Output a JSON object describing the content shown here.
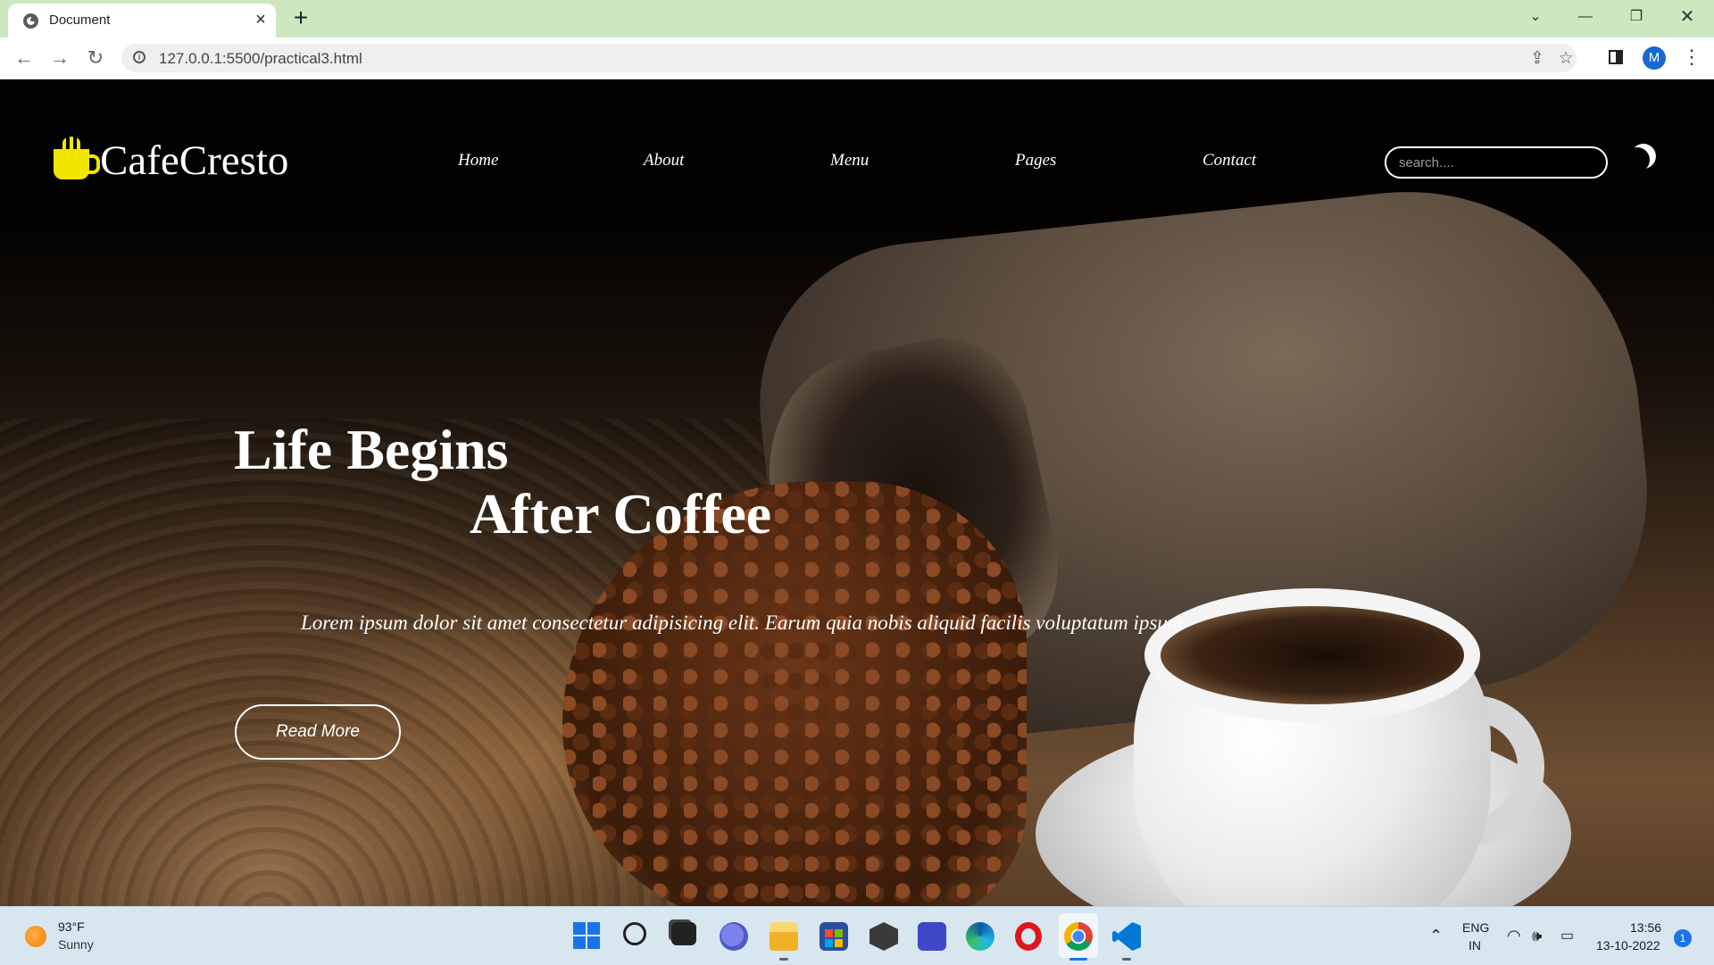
{
  "browser": {
    "tab_title": "Document",
    "url": "127.0.0.1:5500/practical3.html",
    "profile_initial": "M"
  },
  "site": {
    "logo_text": "CafeCresto",
    "nav": [
      "Home",
      "About",
      "Menu",
      "Pages",
      "Contact"
    ],
    "search_placeholder": "search...."
  },
  "hero": {
    "title_line1": "Life Begins",
    "title_line2": "After Coffee",
    "paragraph": "Lorem ipsum dolor sit amet consectetur adipisicing elit. Earum quia nobis aliquid facilis voluptatum ipsum",
    "button_label": "Read More"
  },
  "taskbar": {
    "weather_temp": "93°F",
    "weather_condition": "Sunny",
    "lang_line1": "ENG",
    "lang_line2": "IN",
    "time": "13:56",
    "date": "13-10-2022",
    "notification_count": "1",
    "apps": [
      "start-icon",
      "search-icon",
      "task-view-icon",
      "teams-chat-icon",
      "file-explorer-icon",
      "microsoft-store-icon",
      "unity-icon",
      "app-icon",
      "edge-icon",
      "opera-icon",
      "chrome-icon",
      "vscode-icon"
    ]
  },
  "colors": {
    "logo_accent": "#f2e600",
    "tabbar": "#cde8c0",
    "page_background": "#000000"
  }
}
